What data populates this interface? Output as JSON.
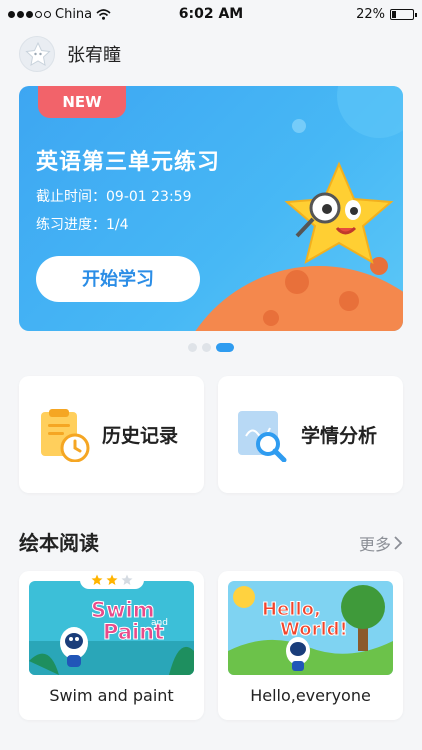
{
  "status_bar": {
    "carrier": "China",
    "time": "6:02 AM",
    "battery": "22%"
  },
  "user": {
    "name": "张宥瞳"
  },
  "banner": {
    "badge": "NEW",
    "title": "英语第三单元练习",
    "deadline": "截止时间：09-01 23:59",
    "progress": "练习进度：1/4",
    "button": "开始学习",
    "colors": {
      "background": "#47b8f5",
      "badge": "#f2636a",
      "button_text": "#2b8de6"
    }
  },
  "carousel": {
    "count": 3,
    "active_index": 2
  },
  "features": [
    {
      "label": "历史记录",
      "icon": "clipboard-clock-icon"
    },
    {
      "label": "学情分析",
      "icon": "magnifier-chart-icon"
    }
  ],
  "picture_books": {
    "title": "绘本阅读",
    "more_label": "更多",
    "items": [
      {
        "name": "Swim and paint",
        "cover_title_1": "Swim",
        "cover_title_and": "and",
        "cover_title_2": "Paint",
        "stars": 2,
        "max_stars": 3
      },
      {
        "name": "Hello,everyone",
        "cover_title_1": "Hello,",
        "cover_title_2": "World!"
      }
    ]
  }
}
